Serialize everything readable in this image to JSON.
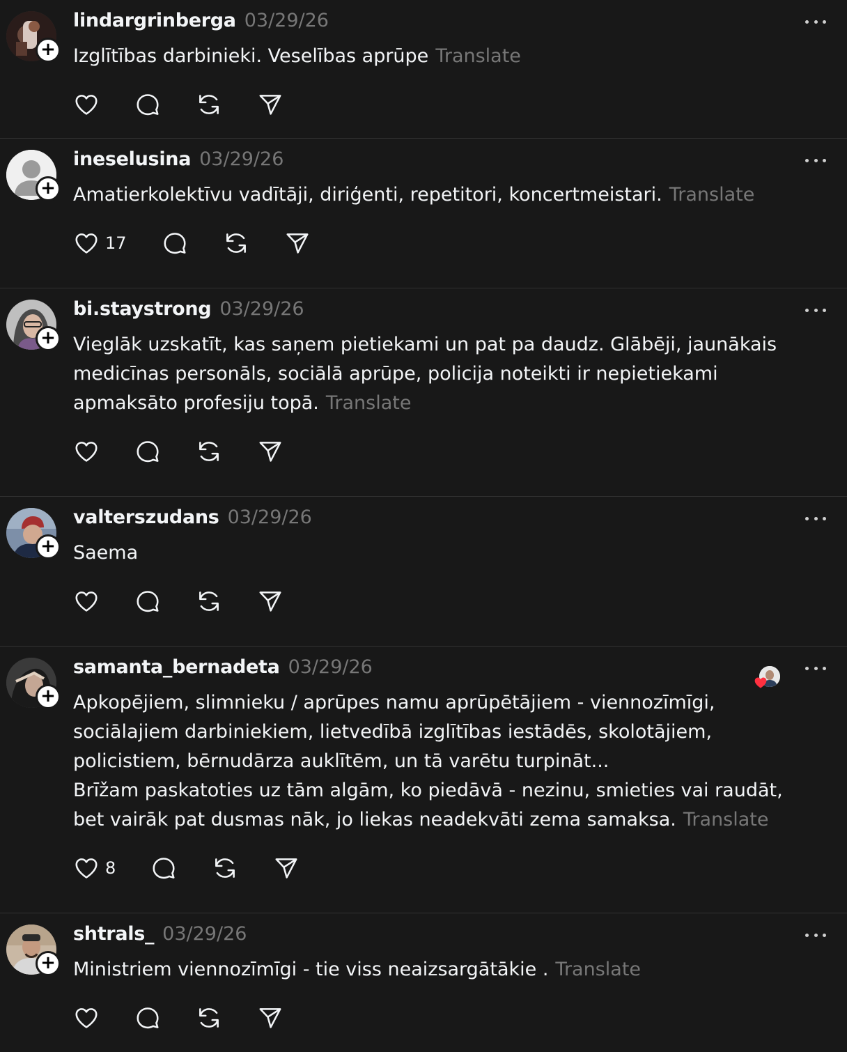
{
  "colors": {
    "background": "#181818",
    "text": "#f3f5f7",
    "muted": "#777777",
    "divider": "#323232",
    "like_heart": "#ff3040"
  },
  "posts": [
    {
      "username": "lindargrinberga",
      "time": "03/29/26",
      "text": "Izglītības darbinieki. Veselības aprūpe",
      "translate": "Translate",
      "likes": "",
      "avatar": "photo-avatar"
    },
    {
      "username": "ineselusina",
      "time": "03/29/26",
      "text": "Amatierkolektīvu vadītāji, diriģenti, repetitori, koncertmeistari.",
      "translate": "Translate",
      "likes": "17",
      "avatar": "default-avatar"
    },
    {
      "username": "bi.staystrong",
      "time": "03/29/26",
      "text": "Vieglāk uzskatīt, kas saņem pietiekami un pat pa daudz. Glābēji, jaunākais medicīnas personāls, sociālā aprūpe, policija noteikti ir nepietiekami apmaksāto profesiju topā.",
      "translate": "Translate",
      "likes": "",
      "avatar": "photo-avatar"
    },
    {
      "username": "valterszudans",
      "time": "03/29/26",
      "text": "Saema",
      "translate": "",
      "likes": "",
      "avatar": "photo-avatar"
    },
    {
      "username": "samanta_bernadeta",
      "time": "03/29/26",
      "text": "Apkopējiem, slimnieku / aprūpes namu aprūpētājiem - viennozīmīgi, sociālajiem darbiniekiem, lietvedībā izglītības iestādēs, skolotājiem, policistiem, bērnudārza auklītēm, un tā varētu turpināt...\nBrīžam paskatoties uz tām algām, ko piedāvā - nezinu, smieties vai raudāt, bet vairāk pat dusmas nāk, jo liekas neadekvāti zema samaksa.",
      "translate": "Translate",
      "likes": "8",
      "avatar": "photo-avatar",
      "liked_by_author": true
    },
    {
      "username": "shtrals_",
      "time": "03/29/26",
      "text": "Ministriem viennozīmīgi - tie viss neaizsargātākie .",
      "translate": "Translate",
      "likes": "",
      "avatar": "photo-avatar"
    }
  ],
  "icons": {
    "like": "heart-icon",
    "reply": "comment-icon",
    "repost": "repost-icon",
    "share": "send-icon",
    "more": "more-icon",
    "follow": "plus-icon"
  }
}
